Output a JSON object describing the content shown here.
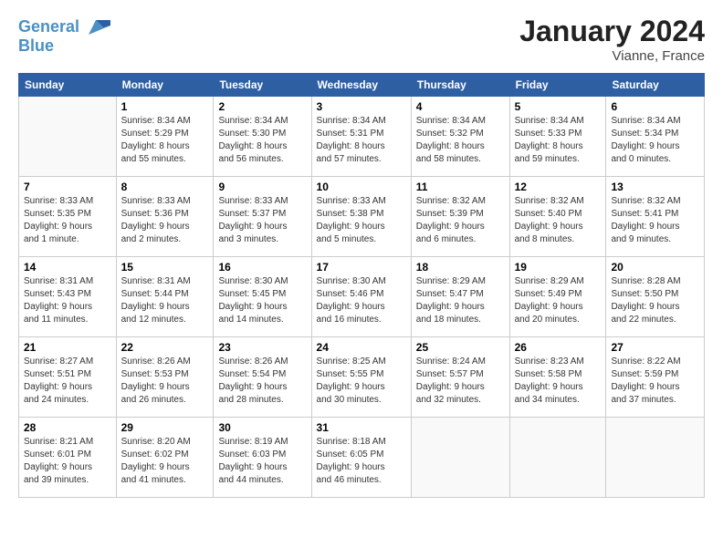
{
  "header": {
    "logo_line1": "General",
    "logo_line2": "Blue",
    "month": "January 2024",
    "location": "Vianne, France"
  },
  "days_of_week": [
    "Sunday",
    "Monday",
    "Tuesday",
    "Wednesday",
    "Thursday",
    "Friday",
    "Saturday"
  ],
  "weeks": [
    [
      {
        "day": "",
        "detail": ""
      },
      {
        "day": "1",
        "detail": "Sunrise: 8:34 AM\nSunset: 5:29 PM\nDaylight: 8 hours\nand 55 minutes."
      },
      {
        "day": "2",
        "detail": "Sunrise: 8:34 AM\nSunset: 5:30 PM\nDaylight: 8 hours\nand 56 minutes."
      },
      {
        "day": "3",
        "detail": "Sunrise: 8:34 AM\nSunset: 5:31 PM\nDaylight: 8 hours\nand 57 minutes."
      },
      {
        "day": "4",
        "detail": "Sunrise: 8:34 AM\nSunset: 5:32 PM\nDaylight: 8 hours\nand 58 minutes."
      },
      {
        "day": "5",
        "detail": "Sunrise: 8:34 AM\nSunset: 5:33 PM\nDaylight: 8 hours\nand 59 minutes."
      },
      {
        "day": "6",
        "detail": "Sunrise: 8:34 AM\nSunset: 5:34 PM\nDaylight: 9 hours\nand 0 minutes."
      }
    ],
    [
      {
        "day": "7",
        "detail": "Sunrise: 8:33 AM\nSunset: 5:35 PM\nDaylight: 9 hours\nand 1 minute."
      },
      {
        "day": "8",
        "detail": "Sunrise: 8:33 AM\nSunset: 5:36 PM\nDaylight: 9 hours\nand 2 minutes."
      },
      {
        "day": "9",
        "detail": "Sunrise: 8:33 AM\nSunset: 5:37 PM\nDaylight: 9 hours\nand 3 minutes."
      },
      {
        "day": "10",
        "detail": "Sunrise: 8:33 AM\nSunset: 5:38 PM\nDaylight: 9 hours\nand 5 minutes."
      },
      {
        "day": "11",
        "detail": "Sunrise: 8:32 AM\nSunset: 5:39 PM\nDaylight: 9 hours\nand 6 minutes."
      },
      {
        "day": "12",
        "detail": "Sunrise: 8:32 AM\nSunset: 5:40 PM\nDaylight: 9 hours\nand 8 minutes."
      },
      {
        "day": "13",
        "detail": "Sunrise: 8:32 AM\nSunset: 5:41 PM\nDaylight: 9 hours\nand 9 minutes."
      }
    ],
    [
      {
        "day": "14",
        "detail": "Sunrise: 8:31 AM\nSunset: 5:43 PM\nDaylight: 9 hours\nand 11 minutes."
      },
      {
        "day": "15",
        "detail": "Sunrise: 8:31 AM\nSunset: 5:44 PM\nDaylight: 9 hours\nand 12 minutes."
      },
      {
        "day": "16",
        "detail": "Sunrise: 8:30 AM\nSunset: 5:45 PM\nDaylight: 9 hours\nand 14 minutes."
      },
      {
        "day": "17",
        "detail": "Sunrise: 8:30 AM\nSunset: 5:46 PM\nDaylight: 9 hours\nand 16 minutes."
      },
      {
        "day": "18",
        "detail": "Sunrise: 8:29 AM\nSunset: 5:47 PM\nDaylight: 9 hours\nand 18 minutes."
      },
      {
        "day": "19",
        "detail": "Sunrise: 8:29 AM\nSunset: 5:49 PM\nDaylight: 9 hours\nand 20 minutes."
      },
      {
        "day": "20",
        "detail": "Sunrise: 8:28 AM\nSunset: 5:50 PM\nDaylight: 9 hours\nand 22 minutes."
      }
    ],
    [
      {
        "day": "21",
        "detail": "Sunrise: 8:27 AM\nSunset: 5:51 PM\nDaylight: 9 hours\nand 24 minutes."
      },
      {
        "day": "22",
        "detail": "Sunrise: 8:26 AM\nSunset: 5:53 PM\nDaylight: 9 hours\nand 26 minutes."
      },
      {
        "day": "23",
        "detail": "Sunrise: 8:26 AM\nSunset: 5:54 PM\nDaylight: 9 hours\nand 28 minutes."
      },
      {
        "day": "24",
        "detail": "Sunrise: 8:25 AM\nSunset: 5:55 PM\nDaylight: 9 hours\nand 30 minutes."
      },
      {
        "day": "25",
        "detail": "Sunrise: 8:24 AM\nSunset: 5:57 PM\nDaylight: 9 hours\nand 32 minutes."
      },
      {
        "day": "26",
        "detail": "Sunrise: 8:23 AM\nSunset: 5:58 PM\nDaylight: 9 hours\nand 34 minutes."
      },
      {
        "day": "27",
        "detail": "Sunrise: 8:22 AM\nSunset: 5:59 PM\nDaylight: 9 hours\nand 37 minutes."
      }
    ],
    [
      {
        "day": "28",
        "detail": "Sunrise: 8:21 AM\nSunset: 6:01 PM\nDaylight: 9 hours\nand 39 minutes."
      },
      {
        "day": "29",
        "detail": "Sunrise: 8:20 AM\nSunset: 6:02 PM\nDaylight: 9 hours\nand 41 minutes."
      },
      {
        "day": "30",
        "detail": "Sunrise: 8:19 AM\nSunset: 6:03 PM\nDaylight: 9 hours\nand 44 minutes."
      },
      {
        "day": "31",
        "detail": "Sunrise: 8:18 AM\nSunset: 6:05 PM\nDaylight: 9 hours\nand 46 minutes."
      },
      {
        "day": "",
        "detail": ""
      },
      {
        "day": "",
        "detail": ""
      },
      {
        "day": "",
        "detail": ""
      }
    ]
  ]
}
